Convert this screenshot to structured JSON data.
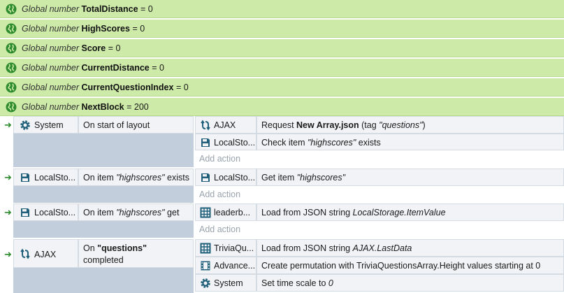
{
  "globals": [
    {
      "prefix": "Global number",
      "name": "TotalDistance",
      "value": "= 0"
    },
    {
      "prefix": "Global number",
      "name": "HighScores",
      "value": "= 0"
    },
    {
      "prefix": "Global number",
      "name": "Score",
      "value": "= 0"
    },
    {
      "prefix": "Global number",
      "name": "CurrentDistance",
      "value": "= 0"
    },
    {
      "prefix": "Global number",
      "name": "CurrentQuestionIndex",
      "value": "= 0"
    },
    {
      "prefix": "Global number",
      "name": "NextBlock",
      "value": "= 200"
    }
  ],
  "events": {
    "e1": {
      "cond_obj": "System",
      "cond_desc": "On start of layout",
      "a1_obj": "AJAX",
      "a1_pre": "Request ",
      "a1_bold": "New Array.json",
      "a1_mid": " (tag ",
      "a1_it": "\"questions\"",
      "a1_post": ")",
      "a2_obj": "LocalSto...",
      "a2_pre": "Check item ",
      "a2_it": "\"highscores\"",
      "a2_post": " exists",
      "add": "Add action"
    },
    "e2": {
      "cond_obj": "LocalSto...",
      "cond_pre": "On item ",
      "cond_it": "\"highscores\"",
      "cond_post": " exists",
      "a1_obj": "LocalSto...",
      "a1_pre": "Get item ",
      "a1_it": "\"highscores\"",
      "add": "Add action"
    },
    "e3": {
      "cond_obj": "LocalSto...",
      "cond_pre": "On item ",
      "cond_it": "\"highscores\"",
      "cond_post": " get",
      "a1_obj": "leaderb...",
      "a1_pre": "Load from JSON string ",
      "a1_it": "LocalStorage.ItemValue",
      "add": "Add action"
    },
    "e4": {
      "cond_obj": "AJAX",
      "cond_pre": "On ",
      "cond_bold": "\"questions\"",
      "cond_line2": "completed",
      "a1_obj": "TriviaQu...",
      "a1_pre": "Load from JSON string ",
      "a1_it": "AJAX.LastData",
      "a2_obj": "Advance...",
      "a2_text": "Create permutation with TriviaQuestionsArray.Height values starting at 0",
      "a3_obj": "System",
      "a3_pre": "Set time scale to ",
      "a3_it": "0"
    }
  },
  "colors": {
    "global_bg": "#cdeaa8",
    "globe": "#2e8b2e",
    "event_shade": "#c3cedd",
    "icon": "#1f5f7a"
  }
}
